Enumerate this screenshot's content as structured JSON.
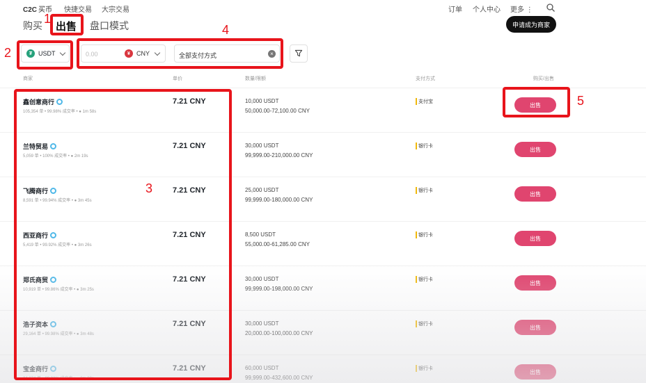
{
  "nav": {
    "brand": "C2C",
    "brand_sub": "买币",
    "links": [
      "快捷交易",
      "大宗交易"
    ],
    "right": [
      "订单",
      "个人中心",
      "更多 ⋮"
    ]
  },
  "tabs": {
    "buy": "购买",
    "sell": "出售",
    "mode": "盘口模式"
  },
  "merchant_button": "申请成为商家",
  "filters": {
    "asset": "USDT",
    "amount_placeholder": "0.00",
    "fiat": "CNY",
    "payment": "全部支付方式"
  },
  "table_headers": {
    "merchant": "商家",
    "price": "单价",
    "amount": "数量/限额",
    "payment": "支付方式",
    "action": "购买/出售"
  },
  "rows": [
    {
      "name": "鑫创意商行",
      "orders": "105,354 单",
      "completion": "99.98% 成交率",
      "time": "1m 58s",
      "price": "7.21 CNY",
      "available": "10,000 USDT",
      "limit": "50,000.00-72,100.00 CNY",
      "payment": "支付宝",
      "action": "出售"
    },
    {
      "name": "兰特贸易",
      "orders": "5,059 单",
      "completion": "100% 成交率",
      "time": "2m 19s",
      "price": "7.21 CNY",
      "available": "30,000 USDT",
      "limit": "99,999.00-210,000.00 CNY",
      "payment": "银行卡",
      "action": "出售"
    },
    {
      "name": "飞腾商行",
      "orders": "8,591 单",
      "completion": "99.94% 成交率",
      "time": "3m 45s",
      "price": "7.21 CNY",
      "available": "25,000 USDT",
      "limit": "99,999.00-180,000.00 CNY",
      "payment": "银行卡",
      "action": "出售"
    },
    {
      "name": "西亚商行",
      "orders": "5,419 单",
      "completion": "99.92% 成交率",
      "time": "3m 26s",
      "price": "7.21 CNY",
      "available": "8,500 USDT",
      "limit": "55,000.00-61,285.00 CNY",
      "payment": "银行卡",
      "action": "出售"
    },
    {
      "name": "郑氏商贸",
      "orders": "10,919 单",
      "completion": "99.86% 成交率",
      "time": "3m 25s",
      "price": "7.21 CNY",
      "available": "30,000 USDT",
      "limit": "99,999.00-198,000.00 CNY",
      "payment": "银行卡",
      "action": "出售"
    },
    {
      "name": "浩子资本",
      "orders": "29,164 单",
      "completion": "99.98% 成交率",
      "time": "3m 48s",
      "price": "7.21 CNY",
      "available": "30,000 USDT",
      "limit": "20,000.00-100,000.00 CNY",
      "payment": "银行卡",
      "action": "出售"
    },
    {
      "name": "宝金商行",
      "orders": "24,274 单",
      "completion": "99.93% 成交率",
      "time": "3m 39s",
      "price": "7.21 CNY",
      "available": "60,000 USDT",
      "limit": "99,999.00-432,600.00 CNY",
      "payment": "银行卡",
      "action": "出售"
    }
  ],
  "annotations": [
    "1",
    "2",
    "3",
    "4",
    "5"
  ],
  "colors": {
    "sell_button": "#e0456f",
    "annotation": "#e8141b",
    "verify": "#4fb8e8",
    "usdt": "#26a17b",
    "cny": "#d9363e"
  }
}
